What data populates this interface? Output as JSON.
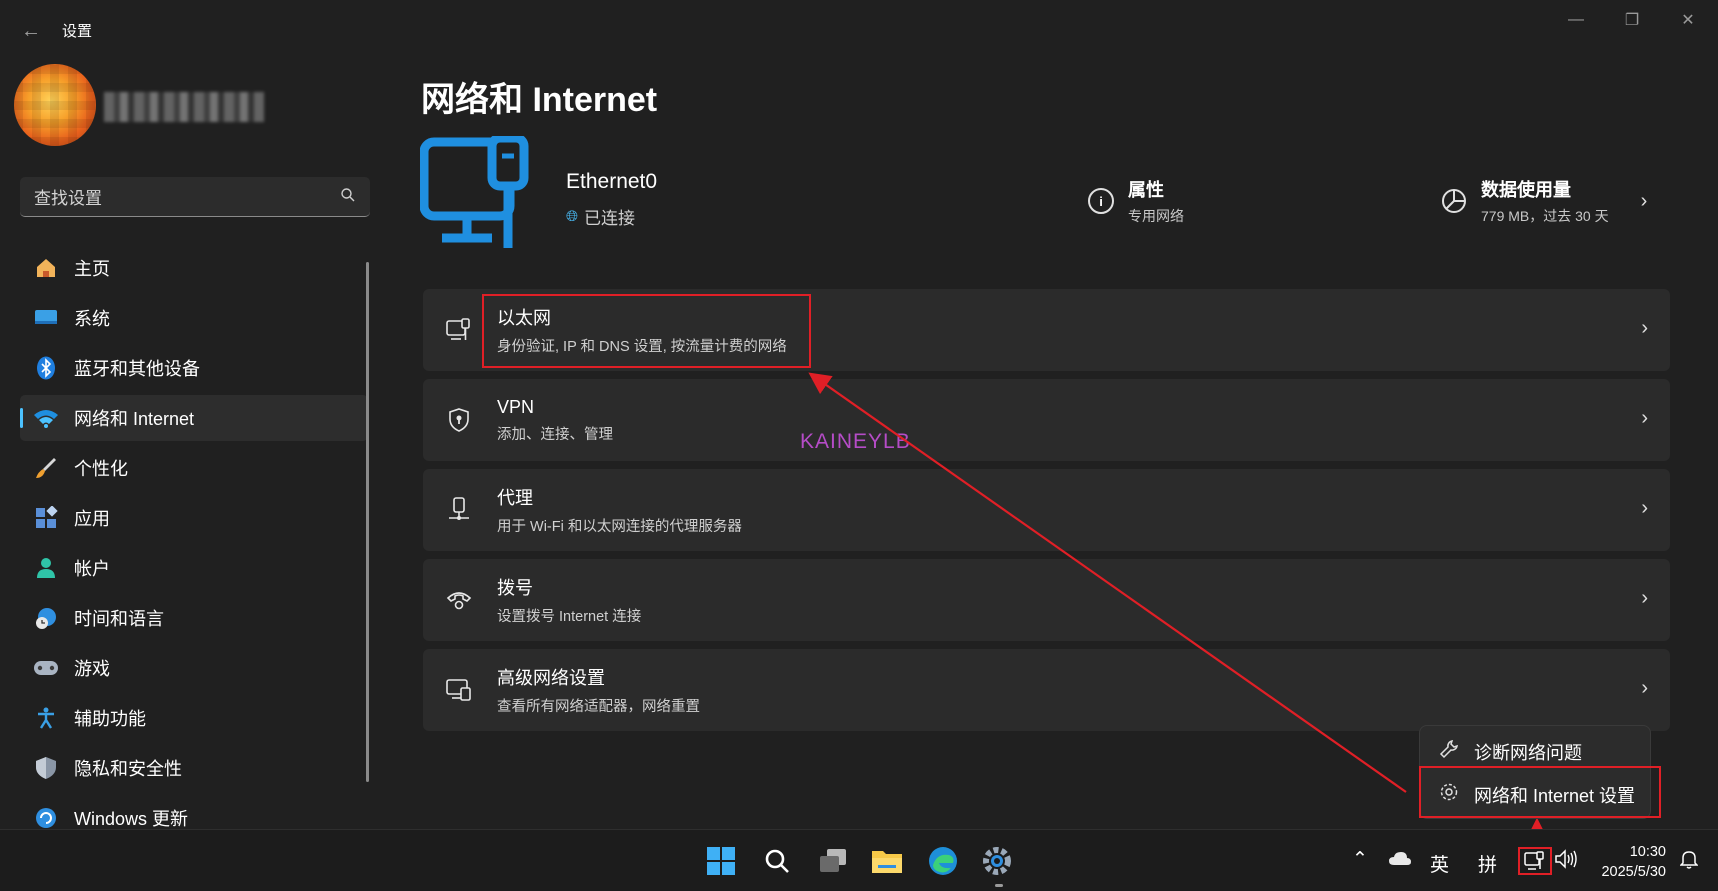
{
  "window": {
    "title": "设置",
    "back_icon": "back-arrow-icon"
  },
  "user": {
    "avatar": "avatar-pixelated",
    "name_blurred": true
  },
  "search": {
    "placeholder": "查找设置"
  },
  "nav": {
    "items": [
      {
        "label": "主页",
        "icon": "home-icon",
        "active": false
      },
      {
        "label": "系统",
        "icon": "display-icon",
        "active": false
      },
      {
        "label": "蓝牙和其他设备",
        "icon": "bluetooth-icon",
        "active": false
      },
      {
        "label": "网络和 Internet",
        "icon": "wifi-icon",
        "active": true
      },
      {
        "label": "个性化",
        "icon": "brush-icon",
        "active": false
      },
      {
        "label": "应用",
        "icon": "apps-icon",
        "active": false
      },
      {
        "label": "帐户",
        "icon": "account-icon",
        "active": false
      },
      {
        "label": "时间和语言",
        "icon": "time-language-icon",
        "active": false
      },
      {
        "label": "游戏",
        "icon": "gamepad-icon",
        "active": false
      },
      {
        "label": "辅助功能",
        "icon": "accessibility-icon",
        "active": false
      },
      {
        "label": "隐私和安全性",
        "icon": "shield-icon",
        "active": false
      },
      {
        "label": "Windows 更新",
        "icon": "update-icon",
        "active": false
      }
    ]
  },
  "page": {
    "title": "网络和 Internet",
    "connection": {
      "name": "Ethernet0",
      "status": "已连接"
    },
    "properties": {
      "title": "属性",
      "subtitle": "专用网络"
    },
    "data_usage": {
      "title": "数据使用量",
      "subtitle": "779 MB，过去 30 天"
    },
    "cards": [
      {
        "title": "以太网",
        "subtitle": "身份验证, IP 和 DNS 设置, 按流量计费的网络",
        "icon": "ethernet-icon"
      },
      {
        "title": "VPN",
        "subtitle": "添加、连接、管理",
        "icon": "vpn-shield-icon"
      },
      {
        "title": "代理",
        "subtitle": "用于 Wi-Fi 和以太网连接的代理服务器",
        "icon": "proxy-icon"
      },
      {
        "title": "拨号",
        "subtitle": "设置拨号 Internet 连接",
        "icon": "dialup-icon"
      },
      {
        "title": "高级网络设置",
        "subtitle": "查看所有网络适配器，网络重置",
        "icon": "advanced-network-icon"
      }
    ]
  },
  "watermark": "KAINEYLB",
  "context_menu": {
    "items": [
      {
        "label": "诊断网络问题",
        "icon": "wrench-icon"
      },
      {
        "label": "网络和 Internet 设置",
        "icon": "gear-icon"
      }
    ]
  },
  "taskbar": {
    "apps": [
      "start-icon",
      "search-icon",
      "task-view-icon",
      "file-explorer-icon",
      "edge-icon",
      "settings-icon"
    ],
    "tray": {
      "ime_lang": "英",
      "ime_mode": "拼"
    },
    "clock": {
      "time": "10:30",
      "date": "2025/5/30"
    }
  },
  "colors": {
    "accent": "#4cc2ff",
    "highlight": "#e01f26",
    "background": "#202020",
    "card": "#2b2b2b"
  }
}
